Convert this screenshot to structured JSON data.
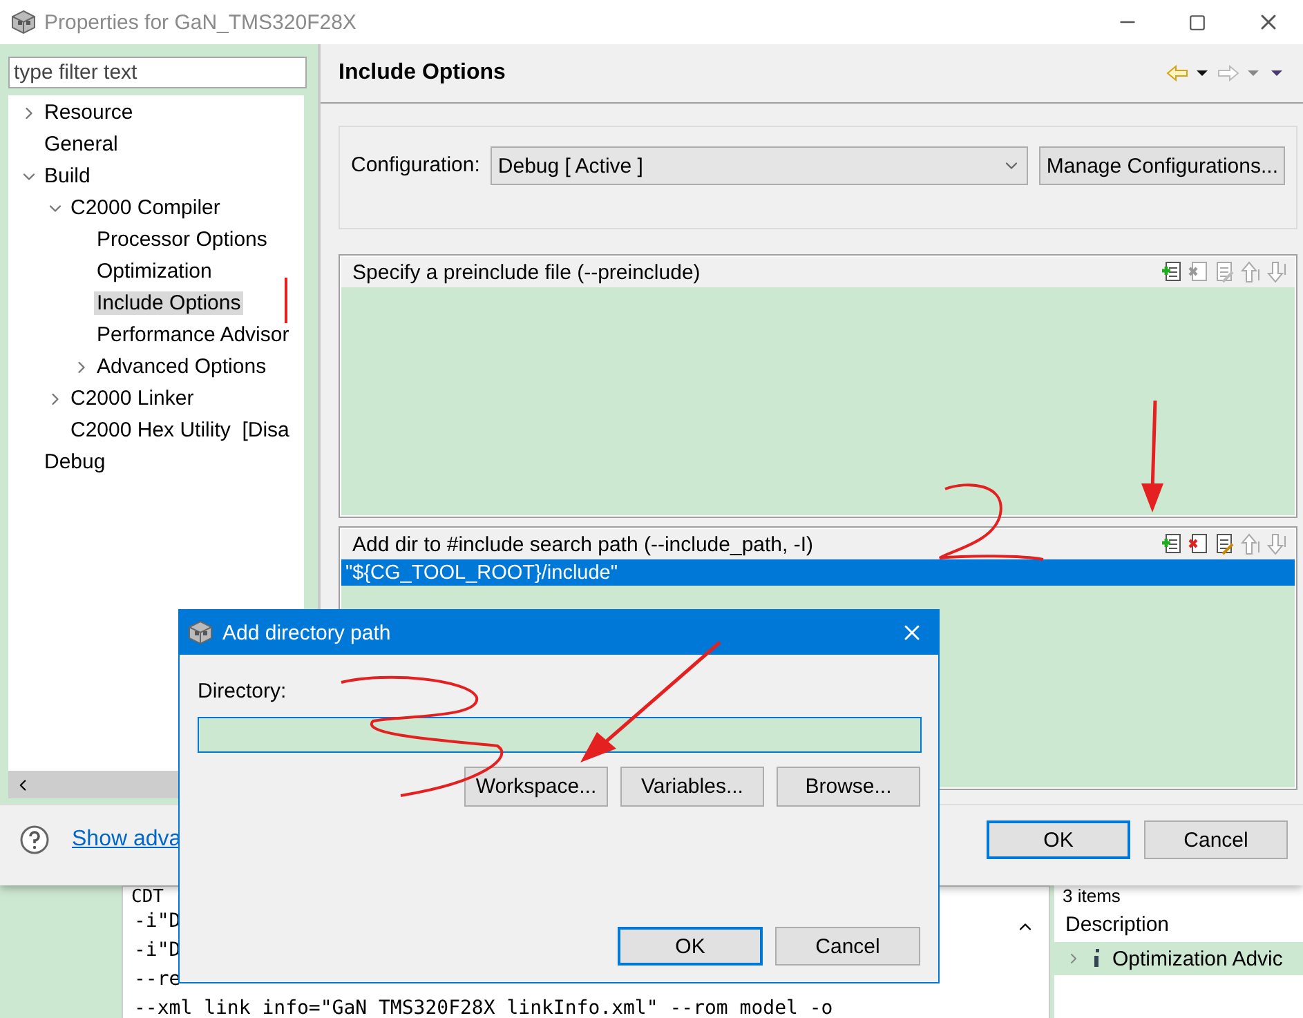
{
  "window": {
    "title": "Properties for GaN_TMS320F28X"
  },
  "filter": {
    "placeholder": "type filter text"
  },
  "tree": [
    {
      "label": "Resource",
      "expanded": false
    },
    {
      "label": "General"
    },
    {
      "label": "Build",
      "expanded": true,
      "children": [
        {
          "label": "C2000 Compiler",
          "expanded": true,
          "children": [
            {
              "label": "Processor Options",
              "selected": false
            },
            {
              "label": "Optimization",
              "selected": false
            },
            {
              "label": "Include Options",
              "selected": true
            },
            {
              "label": "Performance Advisor",
              "selected": false
            },
            {
              "label": "Advanced Options",
              "expanded": false,
              "selected": false
            }
          ]
        },
        {
          "label": "C2000 Linker",
          "expanded": false
        },
        {
          "label": "C2000 Hex Utility  [Disa"
        }
      ]
    },
    {
      "label": "Debug"
    }
  ],
  "page": {
    "title": "Include Options",
    "configuration_label": "Configuration:",
    "configuration": "Debug  [ Active ]",
    "manage_button": "Manage Configurations..."
  },
  "lists": [
    {
      "title": "Specify a preinclude file (--preinclude)",
      "tools": [
        {
          "kind": "add",
          "disabled": false
        },
        {
          "kind": "delete",
          "disabled": true
        },
        {
          "kind": "edit",
          "disabled": true
        },
        {
          "kind": "up",
          "disabled": true
        },
        {
          "kind": "down",
          "disabled": true
        }
      ]
    },
    {
      "title": "Add dir to #include search path (--include_path, -I)",
      "tools": [
        {
          "kind": "add",
          "disabled": false
        },
        {
          "kind": "delete",
          "disabled": false
        },
        {
          "kind": "edit",
          "disabled": false
        },
        {
          "kind": "up",
          "disabled": true
        },
        {
          "kind": "down",
          "disabled": true
        }
      ],
      "items": [
        {
          "text": "\"${CG_TOOL_ROOT}/include\"",
          "selected": true
        }
      ]
    }
  ],
  "footer": {
    "link": "Show adva",
    "buttons": [
      {
        "label": "OK",
        "default": true
      },
      {
        "label": "Cancel",
        "default": false
      }
    ]
  },
  "console": {
    "title": "CDT",
    "lines": [
      "-i\"D",
      "-i\"D",
      "--re",
      "--xml link info=\"GaN TMS320F28X linkInfo.xml\" --rom model -o"
    ]
  },
  "problems": {
    "count": "3 items",
    "column": "Description",
    "rows": [
      {
        "text": "Optimization Advic"
      }
    ]
  },
  "dialog": {
    "title": "Add directory path",
    "label": "Directory:",
    "buttons": [
      "Workspace...",
      "Variables...",
      "Browse..."
    ],
    "actions": [
      {
        "label": "OK",
        "default": true
      },
      {
        "label": "Cancel",
        "default": false
      }
    ]
  }
}
